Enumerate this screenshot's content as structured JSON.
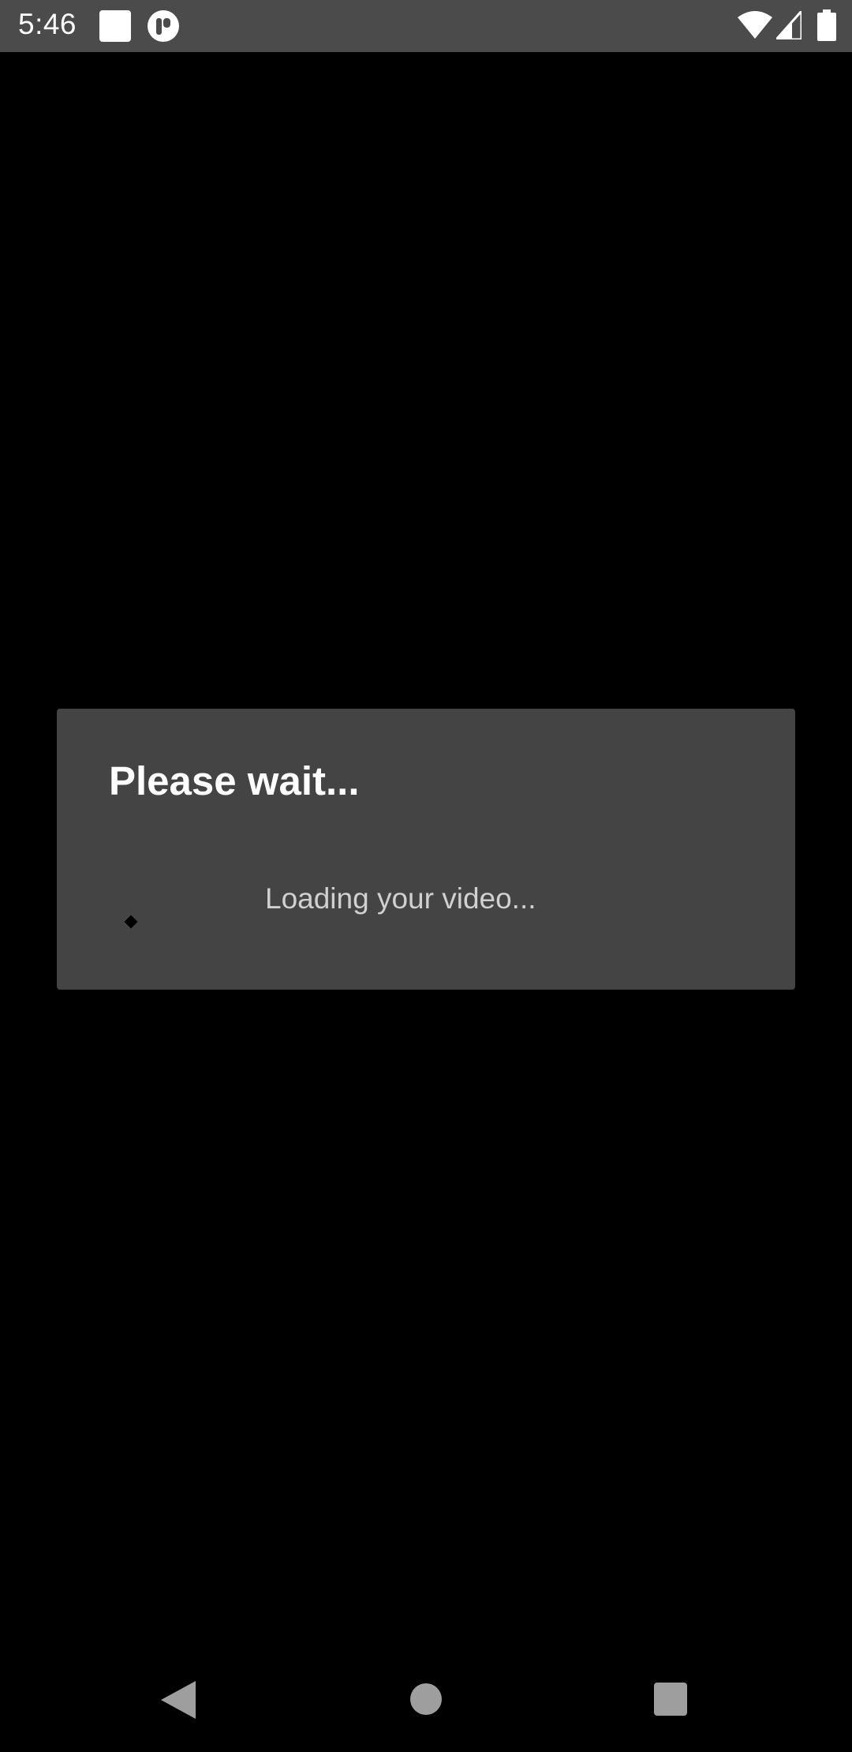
{
  "status_bar": {
    "time": "5:46",
    "icons": [
      "notification-square-icon",
      "app-notification-icon",
      "wifi-icon",
      "signal-icon",
      "battery-icon"
    ],
    "background": "#4b4b4b"
  },
  "dialog": {
    "title": "Please wait...",
    "message": "Loading your video...",
    "background": "#444444"
  },
  "nav_bar": {
    "icons": [
      "back-icon",
      "home-icon",
      "recents-icon"
    ]
  },
  "colors": {
    "screen_background": "#000000",
    "nav_icon": "#9e9e9e",
    "message_text": "#d0d0d0"
  }
}
